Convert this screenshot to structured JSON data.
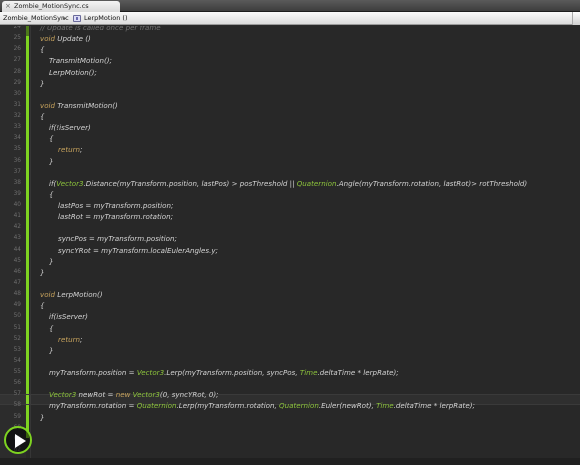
{
  "tab": {
    "title": "Zombie_MotionSync.cs",
    "close_glyph": "×"
  },
  "navbar": {
    "class_name": "Zombie_MotionSync",
    "separator": "▸",
    "method_name": "LerpMotion ()"
  },
  "colors": {
    "accent": "#7ed321",
    "keyword": "#c7a35d",
    "type": "#8dc43c",
    "comment": "#727272",
    "text": "#d4d4d4"
  },
  "code_lines": [
    {
      "n": "24",
      "tokens": [
        {
          "t": "// Update is called once per frame",
          "c": "com"
        }
      ]
    },
    {
      "n": "25",
      "tokens": [
        {
          "t": "void",
          "c": "kw"
        },
        {
          "t": " Update ()",
          "c": "pl"
        }
      ]
    },
    {
      "n": "26",
      "tokens": [
        {
          "t": "{",
          "c": "pl"
        }
      ]
    },
    {
      "n": "27",
      "tokens": [
        {
          "t": "    TransmitMotion();",
          "c": "pl"
        }
      ]
    },
    {
      "n": "28",
      "tokens": [
        {
          "t": "    LerpMotion();",
          "c": "pl"
        }
      ]
    },
    {
      "n": "29",
      "tokens": [
        {
          "t": "}",
          "c": "pl"
        }
      ]
    },
    {
      "n": "30",
      "tokens": []
    },
    {
      "n": "31",
      "tokens": [
        {
          "t": "void",
          "c": "kw"
        },
        {
          "t": " TransmitMotion()",
          "c": "pl"
        }
      ]
    },
    {
      "n": "32",
      "tokens": [
        {
          "t": "{",
          "c": "pl"
        }
      ]
    },
    {
      "n": "33",
      "tokens": [
        {
          "t": "    ",
          "c": "pl"
        },
        {
          "t": "if",
          "c": "pl"
        },
        {
          "t": "(!isServer)",
          "c": "pl"
        }
      ]
    },
    {
      "n": "34",
      "tokens": [
        {
          "t": "    {",
          "c": "pl"
        }
      ]
    },
    {
      "n": "35",
      "tokens": [
        {
          "t": "        ",
          "c": "pl"
        },
        {
          "t": "return",
          "c": "kw"
        },
        {
          "t": ";",
          "c": "pl"
        }
      ]
    },
    {
      "n": "36",
      "tokens": [
        {
          "t": "    }",
          "c": "pl"
        }
      ]
    },
    {
      "n": "37",
      "tokens": []
    },
    {
      "n": "38",
      "tokens": [
        {
          "t": "    if(",
          "c": "pl"
        },
        {
          "t": "Vector3",
          "c": "cls"
        },
        {
          "t": ".Distance(myTransform.position, lastPos) > posThreshold || ",
          "c": "pl"
        },
        {
          "t": "Quaternion",
          "c": "cls"
        },
        {
          "t": ".Angle(myTransform.rotation, lastRot)> rotThreshold)",
          "c": "pl"
        }
      ]
    },
    {
      "n": "39",
      "tokens": [
        {
          "t": "    {",
          "c": "pl"
        }
      ]
    },
    {
      "n": "40",
      "tokens": [
        {
          "t": "        lastPos = myTransform.position;",
          "c": "pl"
        }
      ]
    },
    {
      "n": "41",
      "tokens": [
        {
          "t": "        lastRot = myTransform.rotation;",
          "c": "pl"
        }
      ]
    },
    {
      "n": "42",
      "tokens": []
    },
    {
      "n": "43",
      "tokens": [
        {
          "t": "        syncPos = myTransform.position;",
          "c": "pl"
        }
      ]
    },
    {
      "n": "44",
      "tokens": [
        {
          "t": "        syncYRot = myTransform.localEulerAngles.y;",
          "c": "pl"
        }
      ]
    },
    {
      "n": "45",
      "tokens": [
        {
          "t": "    }",
          "c": "pl"
        }
      ]
    },
    {
      "n": "46",
      "tokens": [
        {
          "t": "}",
          "c": "pl"
        }
      ]
    },
    {
      "n": "47",
      "tokens": []
    },
    {
      "n": "48",
      "tokens": [
        {
          "t": "void",
          "c": "kw"
        },
        {
          "t": " LerpMotion()",
          "c": "pl"
        }
      ]
    },
    {
      "n": "49",
      "tokens": [
        {
          "t": "{",
          "c": "pl"
        }
      ]
    },
    {
      "n": "50",
      "tokens": [
        {
          "t": "    if(isServer)",
          "c": "pl"
        }
      ]
    },
    {
      "n": "51",
      "tokens": [
        {
          "t": "    {",
          "c": "pl"
        }
      ]
    },
    {
      "n": "52",
      "tokens": [
        {
          "t": "        ",
          "c": "pl"
        },
        {
          "t": "return",
          "c": "kw"
        },
        {
          "t": ";",
          "c": "pl"
        }
      ]
    },
    {
      "n": "53",
      "tokens": [
        {
          "t": "    }",
          "c": "pl"
        }
      ]
    },
    {
      "n": "54",
      "tokens": []
    },
    {
      "n": "55",
      "tokens": [
        {
          "t": "    myTransform.position = ",
          "c": "pl"
        },
        {
          "t": "Vector3",
          "c": "cls"
        },
        {
          "t": ".Lerp(myTransform.position, syncPos, ",
          "c": "pl"
        },
        {
          "t": "Time",
          "c": "cls"
        },
        {
          "t": ".deltaTime * lerpRate);",
          "c": "pl"
        }
      ]
    },
    {
      "n": "56",
      "tokens": []
    },
    {
      "n": "57",
      "tokens": [
        {
          "t": "    ",
          "c": "pl"
        },
        {
          "t": "Vector3",
          "c": "cls"
        },
        {
          "t": " newRot = ",
          "c": "pl"
        },
        {
          "t": "new",
          "c": "kw"
        },
        {
          "t": " ",
          "c": "pl"
        },
        {
          "t": "Vector3",
          "c": "cls"
        },
        {
          "t": "(0, syncYRot, 0);",
          "c": "pl"
        }
      ]
    },
    {
      "n": "58",
      "tokens": [
        {
          "t": "    myTransform.rotation = ",
          "c": "pl"
        },
        {
          "t": "Quaternion",
          "c": "cls"
        },
        {
          "t": ".Lerp(myTransform.rotation, ",
          "c": "pl"
        },
        {
          "t": "Quaternion",
          "c": "cls"
        },
        {
          "t": ".Euler(newRot), ",
          "c": "pl"
        },
        {
          "t": "Time",
          "c": "cls"
        },
        {
          "t": ".deltaTime * lerpRate);",
          "c": "pl"
        }
      ]
    },
    {
      "n": "59",
      "tokens": [
        {
          "t": "}",
          "c": "pl"
        }
      ]
    },
    {
      "n": "60",
      "tokens": []
    },
    {
      "n": "61",
      "tokens": []
    },
    {
      "n": "62",
      "tokens": []
    }
  ]
}
